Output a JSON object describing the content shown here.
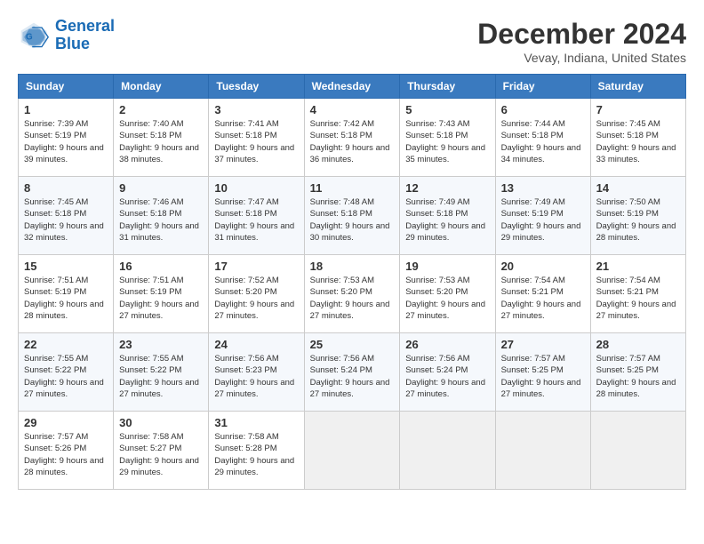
{
  "header": {
    "logo_line1": "General",
    "logo_line2": "Blue",
    "month": "December 2024",
    "location": "Vevay, Indiana, United States"
  },
  "columns": [
    "Sunday",
    "Monday",
    "Tuesday",
    "Wednesday",
    "Thursday",
    "Friday",
    "Saturday"
  ],
  "weeks": [
    [
      {
        "day": "1",
        "sunrise": "Sunrise: 7:39 AM",
        "sunset": "Sunset: 5:19 PM",
        "daylight": "Daylight: 9 hours and 39 minutes."
      },
      {
        "day": "2",
        "sunrise": "Sunrise: 7:40 AM",
        "sunset": "Sunset: 5:18 PM",
        "daylight": "Daylight: 9 hours and 38 minutes."
      },
      {
        "day": "3",
        "sunrise": "Sunrise: 7:41 AM",
        "sunset": "Sunset: 5:18 PM",
        "daylight": "Daylight: 9 hours and 37 minutes."
      },
      {
        "day": "4",
        "sunrise": "Sunrise: 7:42 AM",
        "sunset": "Sunset: 5:18 PM",
        "daylight": "Daylight: 9 hours and 36 minutes."
      },
      {
        "day": "5",
        "sunrise": "Sunrise: 7:43 AM",
        "sunset": "Sunset: 5:18 PM",
        "daylight": "Daylight: 9 hours and 35 minutes."
      },
      {
        "day": "6",
        "sunrise": "Sunrise: 7:44 AM",
        "sunset": "Sunset: 5:18 PM",
        "daylight": "Daylight: 9 hours and 34 minutes."
      },
      {
        "day": "7",
        "sunrise": "Sunrise: 7:45 AM",
        "sunset": "Sunset: 5:18 PM",
        "daylight": "Daylight: 9 hours and 33 minutes."
      }
    ],
    [
      {
        "day": "8",
        "sunrise": "Sunrise: 7:45 AM",
        "sunset": "Sunset: 5:18 PM",
        "daylight": "Daylight: 9 hours and 32 minutes."
      },
      {
        "day": "9",
        "sunrise": "Sunrise: 7:46 AM",
        "sunset": "Sunset: 5:18 PM",
        "daylight": "Daylight: 9 hours and 31 minutes."
      },
      {
        "day": "10",
        "sunrise": "Sunrise: 7:47 AM",
        "sunset": "Sunset: 5:18 PM",
        "daylight": "Daylight: 9 hours and 31 minutes."
      },
      {
        "day": "11",
        "sunrise": "Sunrise: 7:48 AM",
        "sunset": "Sunset: 5:18 PM",
        "daylight": "Daylight: 9 hours and 30 minutes."
      },
      {
        "day": "12",
        "sunrise": "Sunrise: 7:49 AM",
        "sunset": "Sunset: 5:18 PM",
        "daylight": "Daylight: 9 hours and 29 minutes."
      },
      {
        "day": "13",
        "sunrise": "Sunrise: 7:49 AM",
        "sunset": "Sunset: 5:19 PM",
        "daylight": "Daylight: 9 hours and 29 minutes."
      },
      {
        "day": "14",
        "sunrise": "Sunrise: 7:50 AM",
        "sunset": "Sunset: 5:19 PM",
        "daylight": "Daylight: 9 hours and 28 minutes."
      }
    ],
    [
      {
        "day": "15",
        "sunrise": "Sunrise: 7:51 AM",
        "sunset": "Sunset: 5:19 PM",
        "daylight": "Daylight: 9 hours and 28 minutes."
      },
      {
        "day": "16",
        "sunrise": "Sunrise: 7:51 AM",
        "sunset": "Sunset: 5:19 PM",
        "daylight": "Daylight: 9 hours and 27 minutes."
      },
      {
        "day": "17",
        "sunrise": "Sunrise: 7:52 AM",
        "sunset": "Sunset: 5:20 PM",
        "daylight": "Daylight: 9 hours and 27 minutes."
      },
      {
        "day": "18",
        "sunrise": "Sunrise: 7:53 AM",
        "sunset": "Sunset: 5:20 PM",
        "daylight": "Daylight: 9 hours and 27 minutes."
      },
      {
        "day": "19",
        "sunrise": "Sunrise: 7:53 AM",
        "sunset": "Sunset: 5:20 PM",
        "daylight": "Daylight: 9 hours and 27 minutes."
      },
      {
        "day": "20",
        "sunrise": "Sunrise: 7:54 AM",
        "sunset": "Sunset: 5:21 PM",
        "daylight": "Daylight: 9 hours and 27 minutes."
      },
      {
        "day": "21",
        "sunrise": "Sunrise: 7:54 AM",
        "sunset": "Sunset: 5:21 PM",
        "daylight": "Daylight: 9 hours and 27 minutes."
      }
    ],
    [
      {
        "day": "22",
        "sunrise": "Sunrise: 7:55 AM",
        "sunset": "Sunset: 5:22 PM",
        "daylight": "Daylight: 9 hours and 27 minutes."
      },
      {
        "day": "23",
        "sunrise": "Sunrise: 7:55 AM",
        "sunset": "Sunset: 5:22 PM",
        "daylight": "Daylight: 9 hours and 27 minutes."
      },
      {
        "day": "24",
        "sunrise": "Sunrise: 7:56 AM",
        "sunset": "Sunset: 5:23 PM",
        "daylight": "Daylight: 9 hours and 27 minutes."
      },
      {
        "day": "25",
        "sunrise": "Sunrise: 7:56 AM",
        "sunset": "Sunset: 5:24 PM",
        "daylight": "Daylight: 9 hours and 27 minutes."
      },
      {
        "day": "26",
        "sunrise": "Sunrise: 7:56 AM",
        "sunset": "Sunset: 5:24 PM",
        "daylight": "Daylight: 9 hours and 27 minutes."
      },
      {
        "day": "27",
        "sunrise": "Sunrise: 7:57 AM",
        "sunset": "Sunset: 5:25 PM",
        "daylight": "Daylight: 9 hours and 27 minutes."
      },
      {
        "day": "28",
        "sunrise": "Sunrise: 7:57 AM",
        "sunset": "Sunset: 5:25 PM",
        "daylight": "Daylight: 9 hours and 28 minutes."
      }
    ],
    [
      {
        "day": "29",
        "sunrise": "Sunrise: 7:57 AM",
        "sunset": "Sunset: 5:26 PM",
        "daylight": "Daylight: 9 hours and 28 minutes."
      },
      {
        "day": "30",
        "sunrise": "Sunrise: 7:58 AM",
        "sunset": "Sunset: 5:27 PM",
        "daylight": "Daylight: 9 hours and 29 minutes."
      },
      {
        "day": "31",
        "sunrise": "Sunrise: 7:58 AM",
        "sunset": "Sunset: 5:28 PM",
        "daylight": "Daylight: 9 hours and 29 minutes."
      },
      null,
      null,
      null,
      null
    ]
  ]
}
